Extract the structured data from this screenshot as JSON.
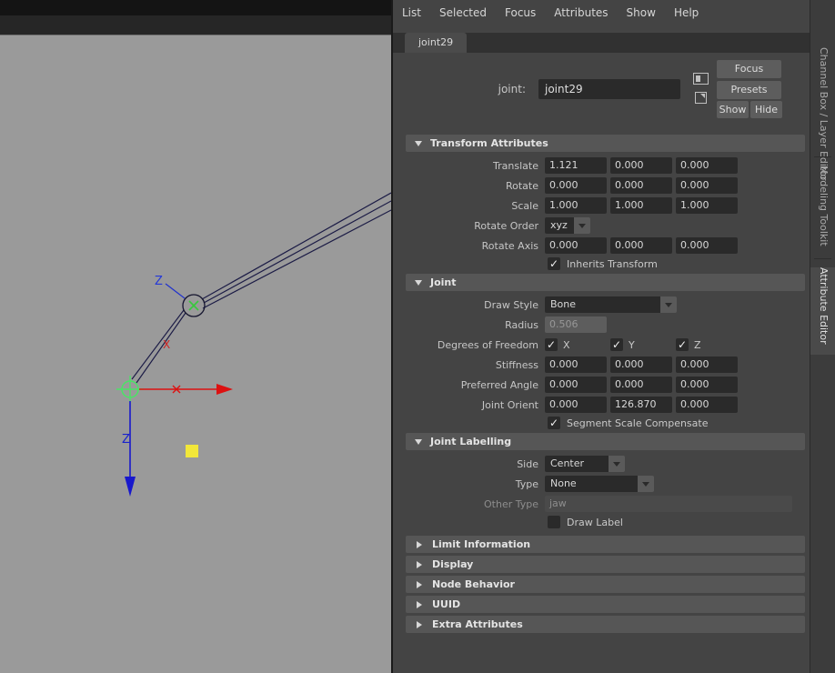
{
  "menubar": {
    "items": [
      "List",
      "Selected",
      "Focus",
      "Attributes",
      "Show",
      "Help"
    ]
  },
  "tabs": {
    "active": "joint29"
  },
  "node_header": {
    "label": "joint:",
    "name_value": "joint29",
    "focus_button": "Focus",
    "presets_button": "Presets",
    "show_button": "Show",
    "hide_button": "Hide"
  },
  "transform_attributes": {
    "title": "Transform Attributes",
    "translate": {
      "label": "Translate",
      "x": "1.121",
      "y": "0.000",
      "z": "0.000"
    },
    "rotate": {
      "label": "Rotate",
      "x": "0.000",
      "y": "0.000",
      "z": "0.000"
    },
    "scale": {
      "label": "Scale",
      "x": "1.000",
      "y": "1.000",
      "z": "1.000"
    },
    "rotate_order": {
      "label": "Rotate Order",
      "value": "xyz"
    },
    "rotate_axis": {
      "label": "Rotate Axis",
      "x": "0.000",
      "y": "0.000",
      "z": "0.000"
    },
    "inherits_transform": {
      "label": "Inherits Transform",
      "checked": true
    }
  },
  "joint_section": {
    "title": "Joint",
    "draw_style": {
      "label": "Draw Style",
      "value": "Bone"
    },
    "radius": {
      "label": "Radius",
      "value": "0.506",
      "disabled": true
    },
    "degrees_of_freedom": {
      "label": "Degrees of Freedom",
      "x_label": "X",
      "y_label": "Y",
      "z_label": "Z",
      "x_checked": true,
      "y_checked": true,
      "z_checked": true
    },
    "stiffness": {
      "label": "Stiffness",
      "x": "0.000",
      "y": "0.000",
      "z": "0.000"
    },
    "preferred_angle": {
      "label": "Preferred Angle",
      "x": "0.000",
      "y": "0.000",
      "z": "0.000"
    },
    "joint_orient": {
      "label": "Joint Orient",
      "x": "0.000",
      "y": "126.870",
      "z": "0.000"
    },
    "segment_scale_compensate": {
      "label": "Segment Scale Compensate",
      "checked": true
    }
  },
  "joint_labelling": {
    "title": "Joint Labelling",
    "side": {
      "label": "Side",
      "value": "Center"
    },
    "type": {
      "label": "Type",
      "value": "None"
    },
    "other_type": {
      "label": "Other Type",
      "value": "jaw",
      "disabled": true
    },
    "draw_label": {
      "label": "Draw Label",
      "checked": false
    }
  },
  "collapsed_sections": [
    "Limit Information",
    "Display",
    "Node Behavior",
    "UUID",
    "Extra Attributes"
  ],
  "side_tabs": [
    "Channel Box / Layer Editor",
    "Modeling Toolkit",
    "Attribute Editor"
  ],
  "icons": {
    "check": "✓"
  },
  "viewport": {
    "labels": {
      "child_z": "Z",
      "bone_x": "X",
      "axis_z": "Z"
    },
    "colors": {
      "x_axis": "#dd1111",
      "z_axis": "#1818cc",
      "joint_selected": "#49e565",
      "bone": "#1c1c46",
      "key_square": "#f2e73a",
      "background": "#9a9a9a"
    }
  }
}
